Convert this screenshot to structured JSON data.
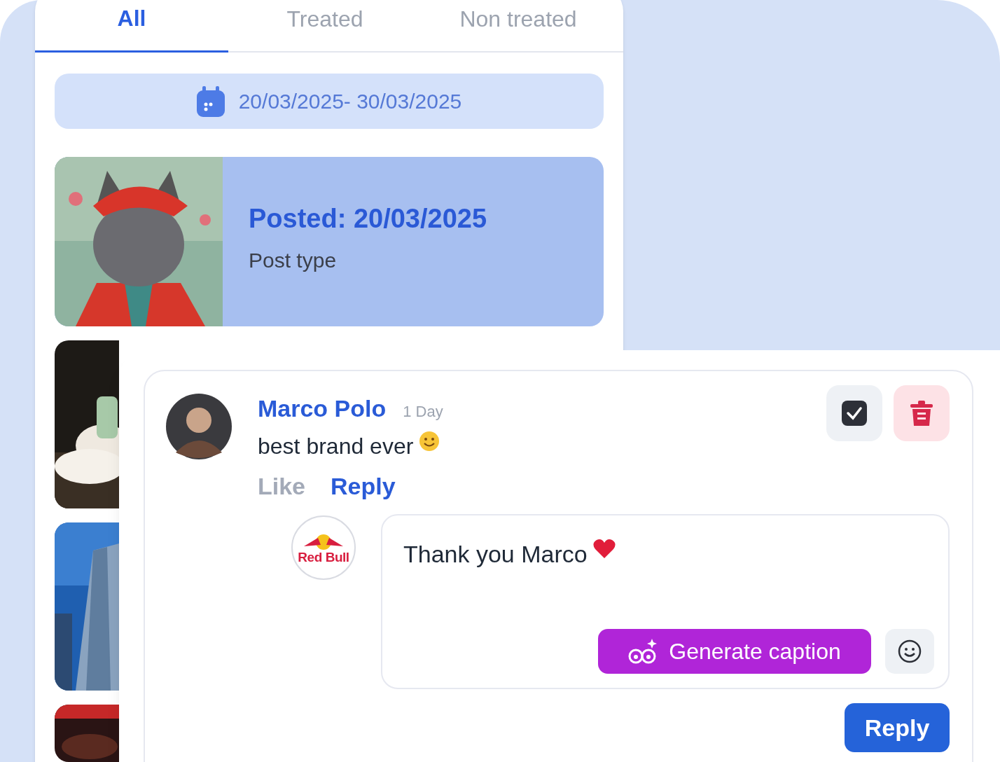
{
  "feed": {
    "tabs": [
      {
        "label": "All",
        "selected": true
      },
      {
        "label": "Treated",
        "selected": false
      },
      {
        "label": "Non treated",
        "selected": false
      }
    ],
    "date_range": "20/03/2025- 30/03/2025",
    "posts": [
      {
        "kind": "post",
        "posted": "Posted: 20/03/2025",
        "post_type": "Post type",
        "selected": true
      }
    ],
    "more_posts": [
      {
        "kind": "food"
      },
      {
        "kind": "building"
      },
      {
        "kind": "dark"
      }
    ]
  },
  "comment_panel": {
    "toolbar": [
      {
        "kind": "check"
      },
      {
        "kind": "delete"
      }
    ],
    "comment": {
      "author": "Marco Polo",
      "time": "1 Day",
      "text": "best brand ever",
      "actions": [
        {
          "label": "Like",
          "selected": false
        },
        {
          "label": "Reply",
          "selected": true
        }
      ]
    },
    "reply": {
      "logo": "Red Bull",
      "value": "Thank you Marco",
      "generate_button": "Generate caption",
      "submit_button": "Reply"
    }
  }
}
